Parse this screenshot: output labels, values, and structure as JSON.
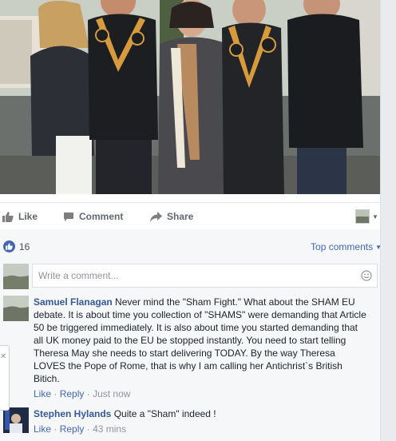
{
  "actions": {
    "like_label": "Like",
    "comment_label": "Comment",
    "share_label": "Share"
  },
  "reactions": {
    "count": "16"
  },
  "sort": {
    "label": "Top comments"
  },
  "composer": {
    "placeholder": "Write a comment..."
  },
  "comments": [
    {
      "author": "Samuel Flanagan",
      "text": "Never mind the \"Sham Fight.\" What about the SHAM EU debate. It is about time you collection of \"SHAMS\" were demanding that Article 50 be triggered immediately. It is also about time you started demanding that all UK money paid to the EU be stopped instantly. You need to start telling Theresa May she needs to start delivering TODAY. By the way Theresa LOVES the Pope of Rome, that is why I am calling her Antichrist`s British Bitich.",
      "like": "Like",
      "reply": "Reply",
      "time": "Just now"
    },
    {
      "author": "Stephen Hylands",
      "text": "Quite a \"Sham\" indeed !",
      "like": "Like",
      "reply": "Reply",
      "time": "43 mins"
    }
  ],
  "colors": {
    "accent": "#4267b2",
    "author": "#365899",
    "muted": "#90949c"
  },
  "icons": [
    "like-icon",
    "comment-icon",
    "share-icon",
    "smiley-icon"
  ]
}
